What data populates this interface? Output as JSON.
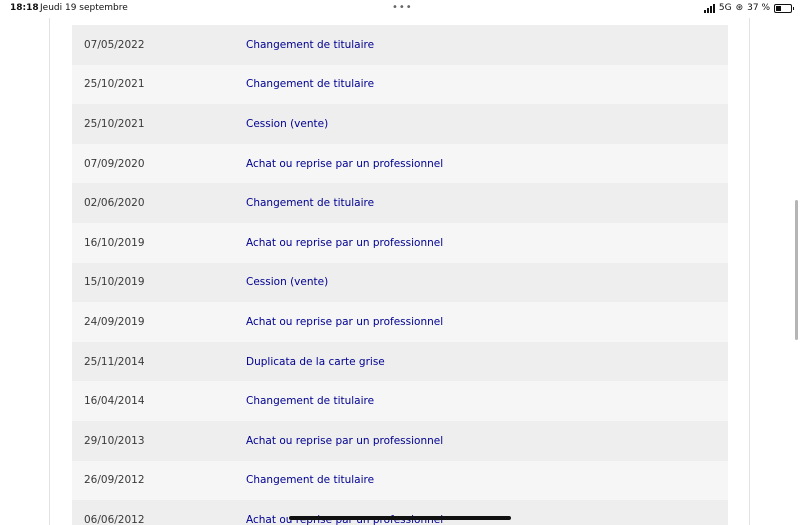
{
  "status_bar": {
    "time": "18:18",
    "date": "Jeudi 19 septembre",
    "network": "5G",
    "battery": "37 %",
    "battery_level": 0.37
  },
  "history": {
    "rows": [
      {
        "date": "07/05/2022",
        "operation": "Changement de titulaire"
      },
      {
        "date": "25/10/2021",
        "operation": "Changement de titulaire"
      },
      {
        "date": "25/10/2021",
        "operation": "Cession (vente)"
      },
      {
        "date": "07/09/2020",
        "operation": "Achat ou reprise par un professionnel"
      },
      {
        "date": "02/06/2020",
        "operation": "Changement de titulaire"
      },
      {
        "date": "16/10/2019",
        "operation": "Achat ou reprise par un professionnel"
      },
      {
        "date": "15/10/2019",
        "operation": "Cession (vente)"
      },
      {
        "date": "24/09/2019",
        "operation": "Achat ou reprise par un professionnel"
      },
      {
        "date": "25/11/2014",
        "operation": "Duplicata de la carte grise"
      },
      {
        "date": "16/04/2014",
        "operation": "Changement de titulaire"
      },
      {
        "date": "29/10/2013",
        "operation": "Achat ou reprise par un professionnel"
      },
      {
        "date": "26/09/2012",
        "operation": "Changement de titulaire"
      },
      {
        "date": "06/06/2012",
        "operation": "Achat ou reprise par un professionnel"
      }
    ]
  }
}
